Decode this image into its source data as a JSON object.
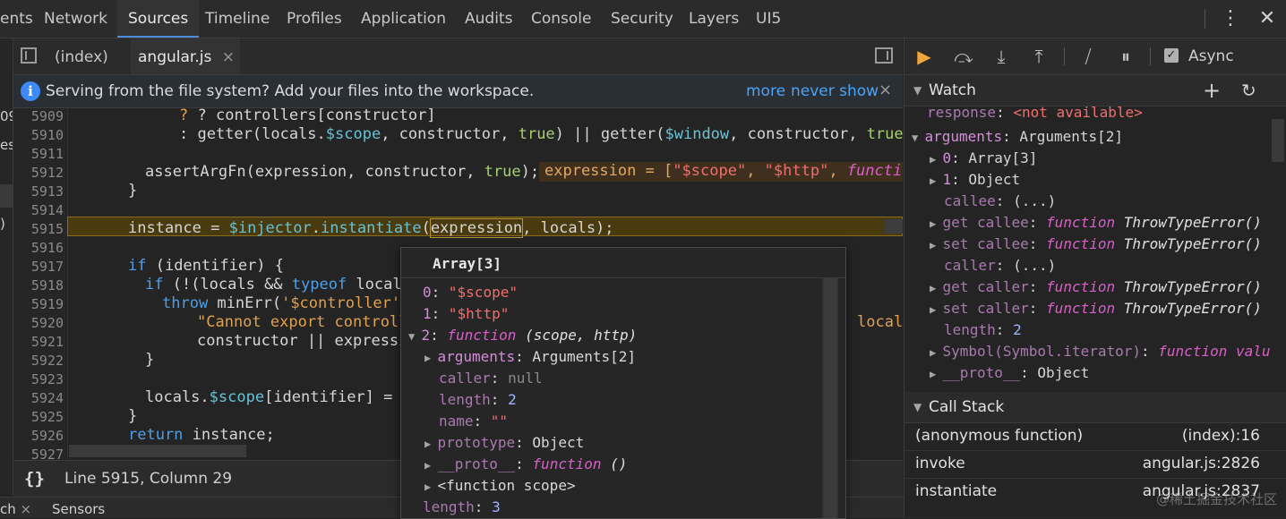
{
  "top_tabs": [
    {
      "label": "ents"
    },
    {
      "label": "Network"
    },
    {
      "label": "Sources"
    },
    {
      "label": "Timeline"
    },
    {
      "label": "Profiles"
    },
    {
      "label": "Application"
    },
    {
      "label": "Audits"
    },
    {
      "label": "Console"
    },
    {
      "label": "Security"
    },
    {
      "label": "Layers"
    },
    {
      "label": "UI5"
    }
  ],
  "left_strip": {
    "frags": [
      "09",
      "est",
      ")"
    ]
  },
  "file_tabs": {
    "index": "(index)",
    "active": "angular.js",
    "close": "×"
  },
  "infobar": {
    "text": "Serving from the file system? Add your files into the workspace.",
    "more": "more",
    "never": "never show",
    "close": "×"
  },
  "editor": {
    "lines": [
      "5909",
      "5910",
      "5911",
      "5912",
      "5913",
      "5914",
      "5915",
      "5916",
      "5917",
      "5918",
      "5919",
      "5920",
      "5921",
      "5922",
      "5923",
      "5924",
      "5925",
      "5926",
      "5927"
    ],
    "l5909": {
      "a": "? controllers[constructor]"
    },
    "l5910": {
      "a": ": getter(locals.",
      "b": "$scope",
      ", c": "",
      "c": ", constructor, ",
      "d": "true",
      ") e": "",
      "e": ") || getter(",
      "f": "$window",
      "g": ", constructor, ",
      "h": "true",
      "i": ");"
    },
    "l5912": {
      "a": "assertArgFn(expression, constructor, ",
      "b": "true",
      "c": ");"
    },
    "inline_value": {
      "a": "expression = [",
      "b": "\"$scope\"",
      "c": ", ",
      "d": "\"$http\"",
      "e": ", ",
      "f": "functio"
    },
    "l5913": {
      "a": "}"
    },
    "l5915": {
      "a": "instance = ",
      "b": "$injector",
      ".": "",
      "c": ".",
      "d": "instantiate",
      "e": "(",
      "f": "expression",
      ", g": "",
      "g": ", locals);"
    },
    "l5917": {
      "a": "if",
      " b": "",
      "b": " (identifier) {"
    },
    "l5918": {
      "a": "if",
      " b": "",
      "b": " (!(locals && ",
      "c": "typeof",
      " d": "",
      "d": " locals"
    },
    "l5919": {
      "a": "throw",
      " b": "",
      "b": " minErr(",
      "c": "'$controller'",
      ") d": "",
      "d": ")"
    },
    "l5920": {
      "a": "\"Cannot export controll",
      "b": "locals`"
    },
    "l5921": {
      "a": "constructor || expressi"
    },
    "l5922": {
      "a": "}"
    },
    "l5924": {
      "a": "locals.",
      "b": "$scope",
      "c": "[identifier] = i"
    },
    "l5925": {
      "a": "}"
    },
    "l5926": {
      "a": "return",
      " b": "",
      "b": " instance;"
    }
  },
  "status": {
    "braces": "{}",
    "position": "Line 5915, Column 29"
  },
  "drawer": {
    "tab1": "ch",
    "close": "×",
    "tab2": "Sensors",
    "close2": "×"
  },
  "debugger": {
    "async": "Async"
  },
  "watch": {
    "title": "Watch",
    "response_name": "response",
    "response_value": "<not available>",
    "args_name": "arguments",
    "args_value": "Arguments[2]",
    "item0_name": "0",
    "item0_value": "Array[3]",
    "item1_name": "1",
    "item1_value": "Object",
    "callee_name": "callee",
    "callee_value": "(...)",
    "get_callee": "get callee",
    "set_callee": "set callee",
    "caller_name": "caller",
    "caller_value": "(...)",
    "get_caller": "get caller",
    "set_caller": "set caller",
    "fn_kw": "function",
    "fn_sig": "ThrowTypeError()",
    "length_name": "length",
    "length_value": "2",
    "symbol_name": "Symbol(Symbol.iterator)",
    "symbol_value": "function valu",
    "proto_name": "__proto__",
    "proto_value": "Object"
  },
  "callstack": {
    "title": "Call Stack",
    "frames": [
      {
        "name": "(anonymous function)",
        "loc": "(index):16"
      },
      {
        "name": "invoke",
        "loc": "angular.js:2826"
      },
      {
        "name": "instantiate",
        "loc": "angular.js:2837"
      }
    ]
  },
  "popover": {
    "title": "Array[3]",
    "i0_name": "0",
    "i0_value": "\"$scope\"",
    "i1_name": "1",
    "i1_value": "\"$http\"",
    "i2_name": "2",
    "i2_kw": "function",
    "i2_sig": "(scope, http)",
    "arguments_name": "arguments",
    "arguments_value": "Arguments[2]",
    "caller_name": "caller",
    "caller_value": "null",
    "length_name": "length",
    "length_value": "2",
    "name_name": "name",
    "name_value": "\"\"",
    "prototype_name": "prototype",
    "prototype_value": "Object",
    "proto_name": "__proto__",
    "proto_kw": "function",
    "proto_sig": "()",
    "scope": "<function scope>",
    "arr_length_name": "length",
    "arr_length_value": "3"
  },
  "watermark": "@稀土掘金技术社区"
}
